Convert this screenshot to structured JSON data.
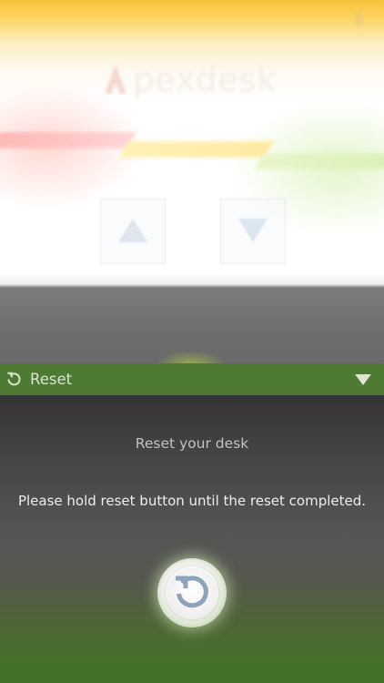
{
  "brand": {
    "name": "pexdesk",
    "trademark": "™"
  },
  "icons": {
    "bluetooth": "bluetooth-icon",
    "up": "arrow-up-icon",
    "down": "arrow-down-icon",
    "reset": "reset-icon",
    "collapse": "chevron-down-icon"
  },
  "reset_section": {
    "title": "Reset",
    "subtitle": "Reset your desk",
    "instruction": "Please hold reset button until the reset completed."
  },
  "colors": {
    "header_green": "#4f7a34",
    "accent_yellow": "#f9c23a",
    "panel_dark": "#3a3838"
  }
}
